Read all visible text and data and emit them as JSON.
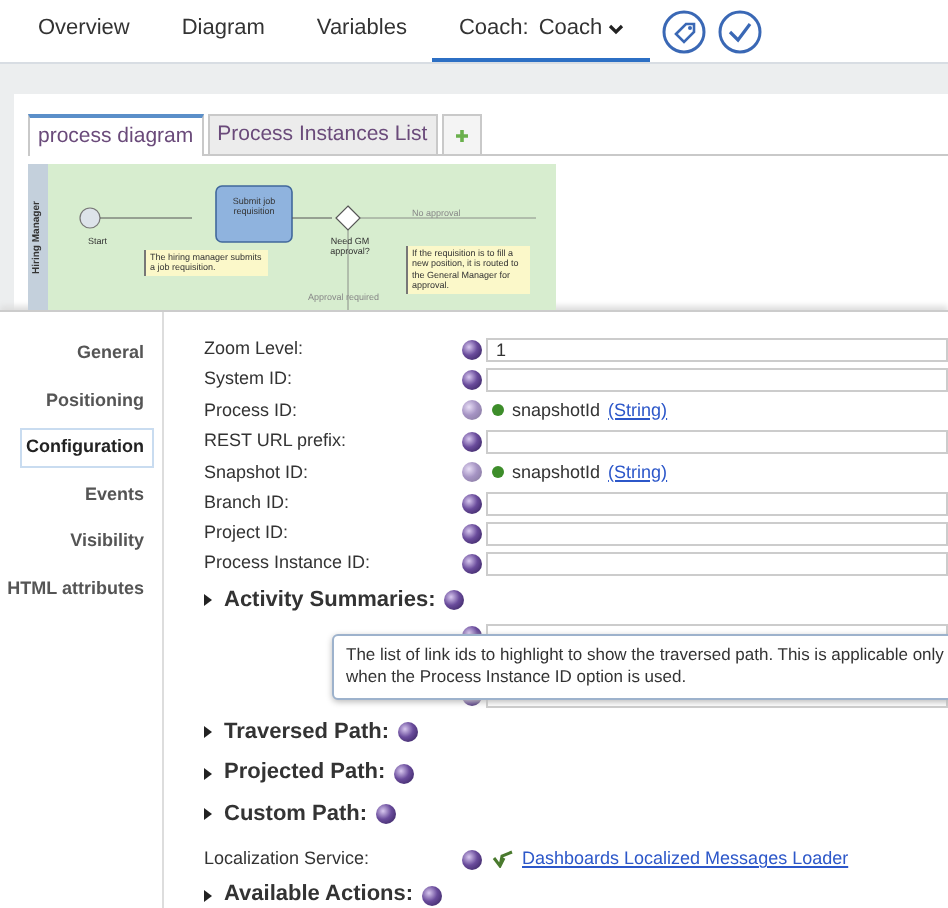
{
  "top_tabs": [
    {
      "label": "Overview",
      "selected": false,
      "kind": "plain"
    },
    {
      "label": "Diagram",
      "selected": false,
      "kind": "plain"
    },
    {
      "label": "Variables",
      "selected": false,
      "kind": "plain"
    },
    {
      "label": "Coach:",
      "value": "Coach",
      "selected": true,
      "kind": "dropdown"
    }
  ],
  "diagram_panel": {
    "tabs": [
      {
        "label": "process diagram",
        "selected": true
      },
      {
        "label": "Process Instances List",
        "selected": false
      }
    ],
    "diagram": {
      "lane": "Hiring Manager",
      "start": "Start",
      "task": "Submit job requisition",
      "gateway": "Need GM approval?",
      "flow_no": "No approval",
      "flow_yes": "Approval required",
      "note_1": "The hiring manager submits a job requisition.",
      "note_2": "If the requisition is to fill a new position, it is routed to the General Manager for approval."
    }
  },
  "sidebar": [
    {
      "label": "General",
      "selected": false
    },
    {
      "label": "Positioning",
      "selected": false
    },
    {
      "label": "Configuration",
      "selected": true
    },
    {
      "label": "Events",
      "selected": false
    },
    {
      "label": "Visibility",
      "selected": false
    },
    {
      "label": "HTML attributes",
      "selected": false
    }
  ],
  "properties": [
    {
      "kind": "field",
      "label": "Zoom Level:",
      "value": "1"
    },
    {
      "kind": "field",
      "label": "System ID:"
    },
    {
      "kind": "binding",
      "label": "Process ID:",
      "variable": "snapshotId",
      "type": "(String)"
    },
    {
      "kind": "field",
      "label": "REST URL prefix:"
    },
    {
      "kind": "binding",
      "label": "Snapshot ID:",
      "variable": "snapshotId",
      "type": "(String)"
    },
    {
      "kind": "field",
      "label": "Branch ID:"
    },
    {
      "kind": "field",
      "label": "Project ID:"
    },
    {
      "kind": "field",
      "label": "Process Instance ID:"
    },
    {
      "kind": "section",
      "label": "Activity Summaries:"
    },
    {
      "kind": "covered"
    },
    {
      "kind": "covered"
    },
    {
      "kind": "covered"
    },
    {
      "kind": "section",
      "label": "Traversed Path:"
    },
    {
      "kind": "section",
      "label": "Projected Path:"
    },
    {
      "kind": "section",
      "label": "Custom Path:"
    },
    {
      "kind": "link",
      "label": "Localization Service:",
      "link": "Dashboards Localized Messages Loader"
    },
    {
      "kind": "section",
      "label": "Available Actions:"
    }
  ],
  "tooltip": "The list of link ids to highlight to show the traversed path. This is applicable only when the Process Instance ID option is used."
}
